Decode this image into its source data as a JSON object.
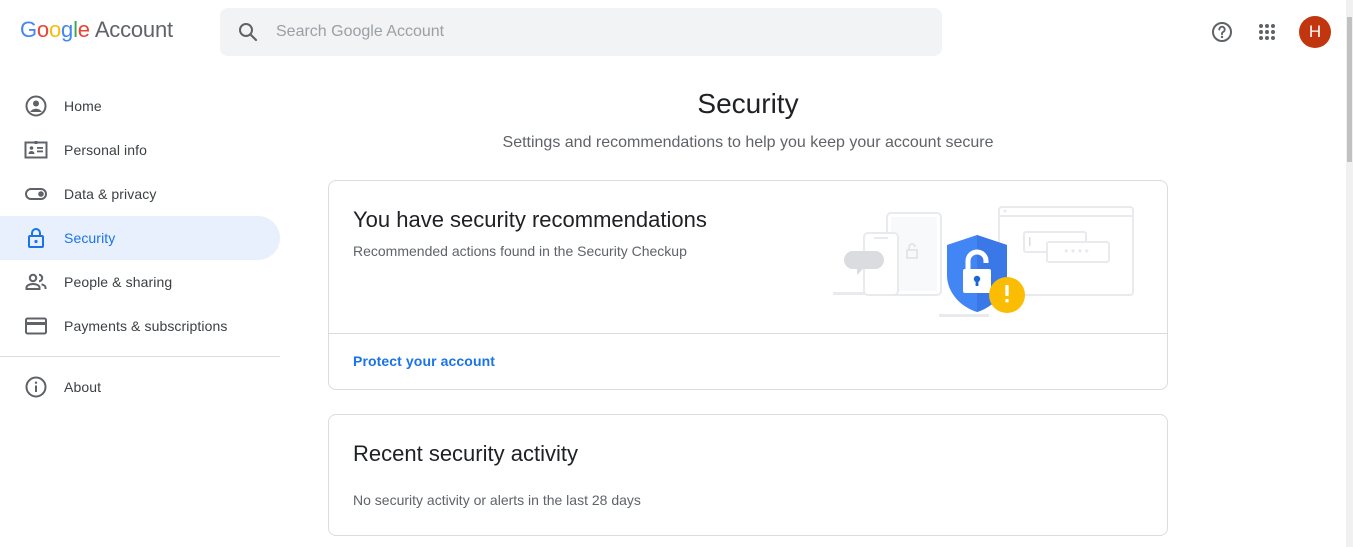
{
  "header": {
    "logo_letters": [
      "G",
      "o",
      "o",
      "g",
      "l",
      "e"
    ],
    "logo_suffix": "Account",
    "search_placeholder": "Search Google Account",
    "search_value": "",
    "avatar_initial": "H",
    "avatar_color": "#c1360e",
    "icons": [
      "help-icon",
      "apps-icon"
    ]
  },
  "sidebar": {
    "items": [
      {
        "label": "Home",
        "icon": "account-circle-icon",
        "active": false
      },
      {
        "label": "Personal info",
        "icon": "id-card-icon",
        "active": false
      },
      {
        "label": "Data & privacy",
        "icon": "toggle-icon",
        "active": false
      },
      {
        "label": "Security",
        "icon": "lock-icon",
        "active": true
      },
      {
        "label": "People & sharing",
        "icon": "people-icon",
        "active": false
      },
      {
        "label": "Payments & subscriptions",
        "icon": "credit-card-icon",
        "active": false
      }
    ],
    "footer_items": [
      {
        "label": "About",
        "icon": "info-icon"
      }
    ]
  },
  "main": {
    "title": "Security",
    "subtitle": "Settings and recommendations to help you keep your account secure",
    "cards": [
      {
        "title": "You have security recommendations",
        "description": "Recommended actions found in the Security Checkup",
        "link_label": "Protect your account",
        "illustration": "security-shield-warning-illustration"
      },
      {
        "title": "Recent security activity",
        "description": "No security activity or alerts in the last 28 days"
      }
    ]
  },
  "colors": {
    "accent": "#1a73e8",
    "active_bg": "#e8f0fe",
    "warning": "#fbbc04",
    "shield": "#4285f4"
  }
}
